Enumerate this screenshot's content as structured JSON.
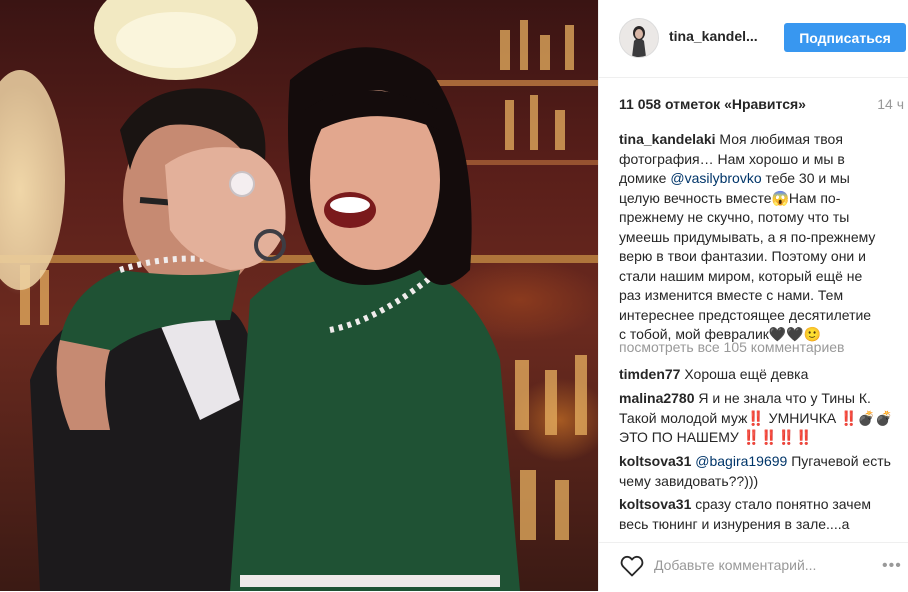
{
  "post": {
    "image_alt": "Фото",
    "header": {
      "username": "tina_kandel...",
      "follow_label": "Подписаться"
    },
    "likes": "11 058 отметок «Нравится»",
    "time": "14 ч",
    "caption": {
      "author": "tina_kandelaki",
      "text_1": " Моя любимая твоя фотография… Нам хорошо и мы в домике ",
      "mention": "@vasilybrovko",
      "text_2": " тебе 30 и мы целую вечность вместе😱Нам по-прежнему не скучно, потому что ты умеешь придумывать, а я по-прежнему верю в твои фантазии. Поэтому они и стали нашим миром, который ещё не раз изменится вместе с нами. Тем интереснее предстоящее десятилетие с тобой, мой февралик🖤🖤🙂"
    },
    "view_all": "посмотреть все 105 комментариев",
    "comments": [
      {
        "user": "timden77",
        "text": " Хороша ещё девка",
        "mention": ""
      },
      {
        "user": "malina2780",
        "text": " Я и не знала что у Тины К. Такой молодой муж‼️ УМНИЧКА ‼️💣💣 ЭТО ПО НАШЕМУ ‼️‼️‼️‼️",
        "mention": ""
      },
      {
        "user": "koltsova31",
        "mention": " @bagira19699",
        "text": " Пугачевой есть чему завидовать??)))"
      },
      {
        "user": "koltsova31",
        "text": " сразу стало понятно зачем весь тюнинг и изнурения в зале....а",
        "mention": ""
      }
    ],
    "add_comment_placeholder": "Добавьте комментарий...",
    "more_options": "•••",
    "colors": {
      "accent": "#3897f0",
      "mention": "#003569",
      "muted": "#999999",
      "border": "#efefef"
    }
  }
}
